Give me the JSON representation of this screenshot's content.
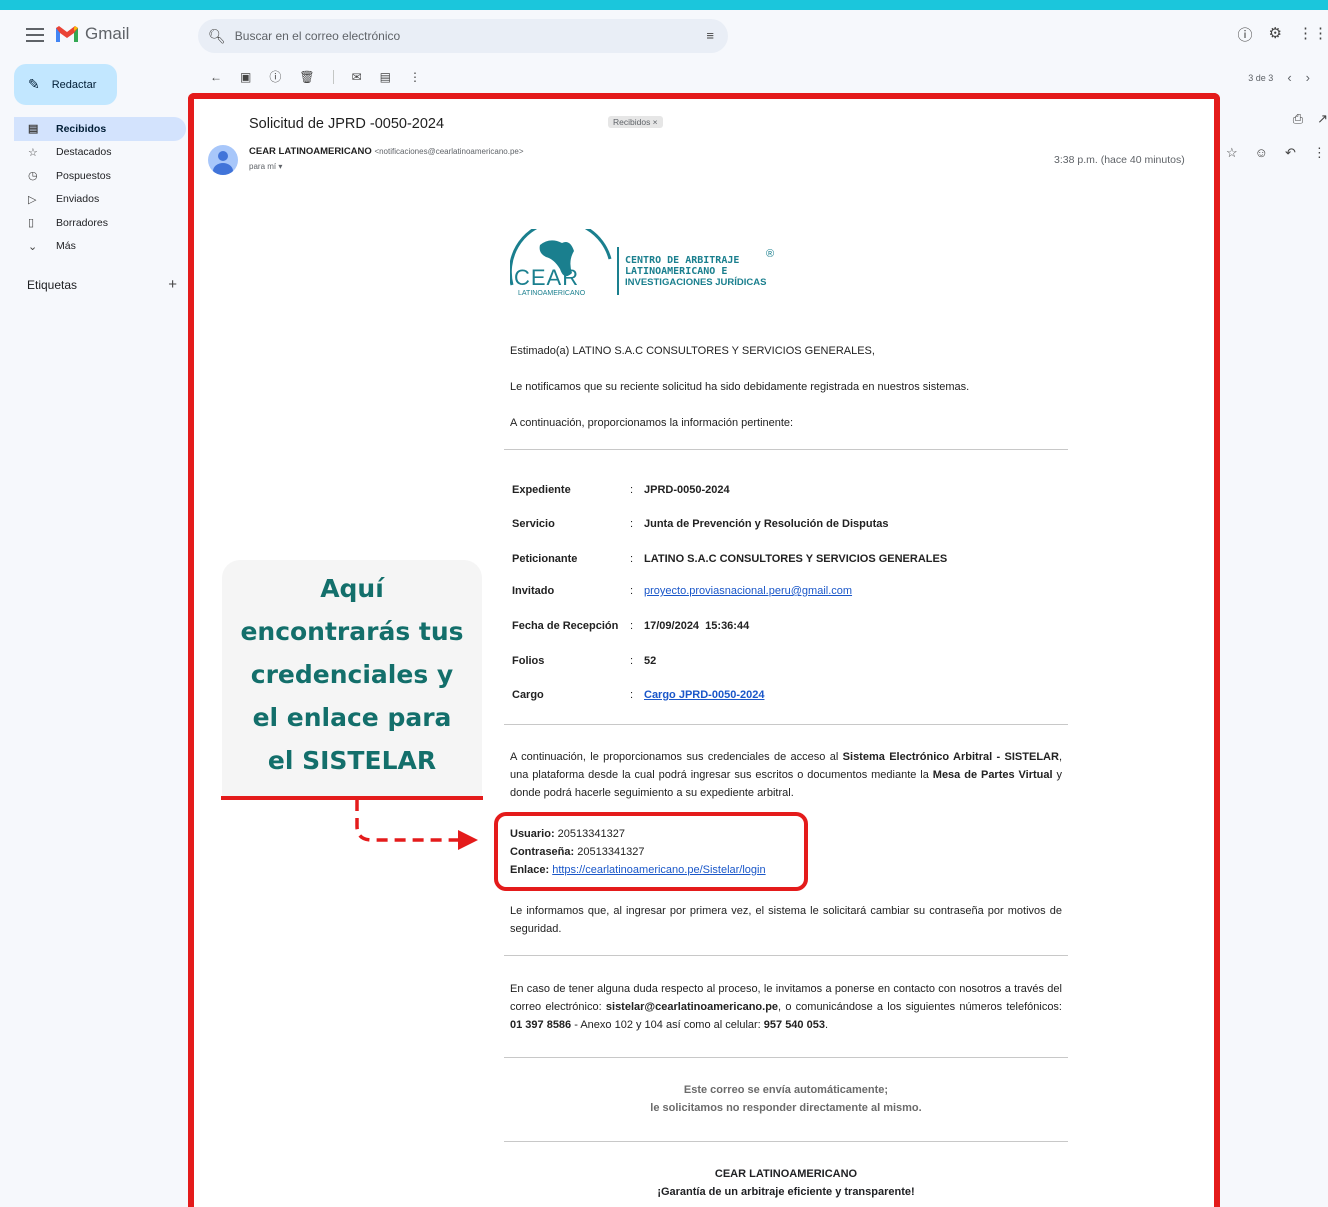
{
  "app": {
    "name": "Gmail"
  },
  "search": {
    "placeholder": "Buscar en el correo electrónico"
  },
  "sidebar": {
    "compose_label": "Redactar",
    "items": [
      {
        "label": "Recibidos",
        "icon": "inbox-icon",
        "active": true
      },
      {
        "label": "Destacados",
        "icon": "star-icon"
      },
      {
        "label": "Pospuestos",
        "icon": "clock-icon"
      },
      {
        "label": "Enviados",
        "icon": "send-icon"
      },
      {
        "label": "Borradores",
        "icon": "draft-icon"
      },
      {
        "label": "Más",
        "icon": "chevron-down-icon"
      }
    ],
    "labels_title": "Etiquetas"
  },
  "pager": {
    "text": "3 de 3"
  },
  "email": {
    "subject": "Solicitud de JPRD -0050-2024",
    "label_chip": "Recibidos ×",
    "sender_name": "CEAR LATINOAMERICANO",
    "sender_addr": "<notificaciones@cearlatinoamericano.pe>",
    "to": "para mí ▾",
    "time": "3:38 p.m. (hace 40 minutos)",
    "logo": {
      "line1": "CENTRO DE ARBITRAJE",
      "line2": "LATINOAMERICANO E",
      "line3": "INVESTIGACIONES JURÍDICAS",
      "acronym": "CEAR",
      "sub": "LATINOAMERICANO",
      "reg": "®"
    },
    "greeting": "Estimado(a) LATINO S.A.C CONSULTORES Y SERVICIOS GENERALES,",
    "para1": "Le notificamos que su reciente solicitud ha sido debidamente registrada en nuestros sistemas.",
    "para2": "A continuación, proporcionamos la información pertinente:",
    "fields": [
      {
        "key": "Expediente",
        "value": "JPRD-0050-2024"
      },
      {
        "key": "Servicio",
        "value": "Junta de Prevención y Resolución de Disputas"
      },
      {
        "key": "Peticionante",
        "value": "LATINO S.A.C CONSULTORES Y SERVICIOS GENERALES"
      },
      {
        "key": "Invitado",
        "value": "proyecto.proviasnacional.peru@gmail.com"
      },
      {
        "key": "Fecha de Recepción",
        "value": "17/09/2024  15:36:44"
      },
      {
        "key": "Folios",
        "value": "52"
      },
      {
        "key": "Cargo",
        "value": "Cargo JPRD-0050-2024"
      }
    ],
    "colon": ":",
    "cred_intro": {
      "a": "A continuación, le proporcionamos sus credenciales de acceso al ",
      "b": "Sistema Electrónico Arbitral - SISTELAR",
      "c": ", una plataforma desde la cual podrá ingresar sus escritos o documentos mediante la ",
      "d": "Mesa de Partes Virtual",
      "e": " y donde podrá hacerle seguimiento a su expediente arbitral."
    },
    "creds": {
      "user_label": "Usuario:",
      "user_value": " 20513341327",
      "pass_label": "Contraseña:",
      "pass_value": " 20513341327",
      "link_label": "Enlace:",
      "link_value": "https://cearlatinoamericano.pe/Sistelar/login"
    },
    "security_note": "Le informamos que, al ingresar por primera vez, el sistema le solicitará cambiar su contraseña por motivos de seguridad.",
    "contact": {
      "a": "En caso de tener alguna duda respecto al proceso, le invitamos a ponerse en contacto con nosotros a través del correo electrónico: ",
      "email": "sistelar@cearlatinoamericano.pe",
      "b": ", o comunicándose a los siguientes números telefónicos: ",
      "phone": "01 397 8586",
      "c": " - Anexo 102 y 104 así como al celular: ",
      "cell": "957 540 053",
      "d": "."
    },
    "auto1": "Este correo se envía automáticamente;",
    "auto2": "le solicitamos no responder directamente al mismo.",
    "footer1": "CEAR LATINOAMERICANO",
    "footer2": "¡Garantía de un arbitraje eficiente y transparente!"
  },
  "callout": {
    "lines": [
      "Aquí",
      "encontrarás tus",
      "credenciales y",
      "el enlace para",
      "el SISTELAR"
    ]
  },
  "colors": {
    "accent": "#e41b1b",
    "callout_text": "#136f6b",
    "background": "#1bc6dc",
    "link": "#1a57c9"
  }
}
